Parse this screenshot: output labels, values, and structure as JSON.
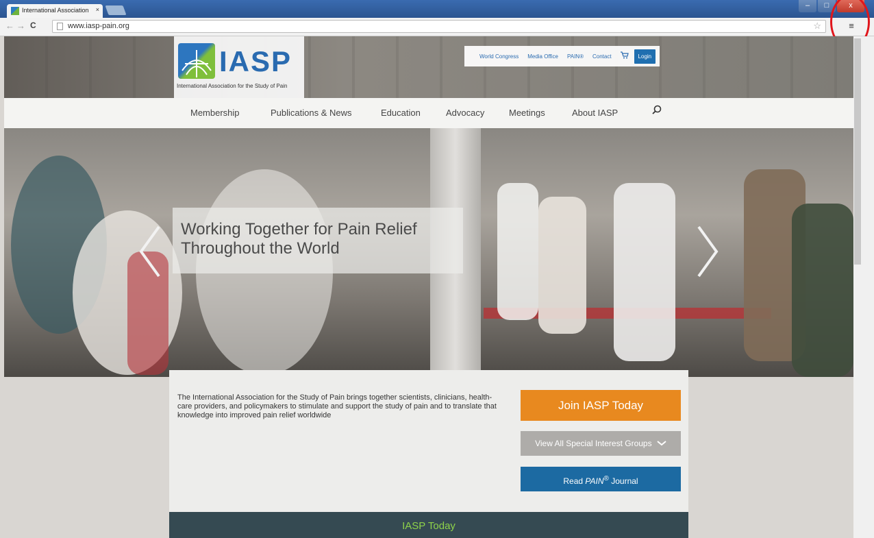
{
  "browser": {
    "tab_title": "International Association",
    "tab_close": "×",
    "url": "www.iasp-pain.org",
    "back_glyph": "←",
    "forward_glyph": "→",
    "reload_glyph": "C",
    "star_glyph": "☆",
    "menu_glyph": "≡",
    "window_controls": {
      "minimize": "–",
      "maximize": "□",
      "close": "x"
    }
  },
  "header": {
    "logo_text": "IASP",
    "logo_tagline": "International Association for the Study of Pain",
    "utility_links": [
      "World Congress",
      "Media Office",
      "PAIN®",
      "Contact"
    ],
    "login_label": "Login",
    "cart_icon": "cart-icon"
  },
  "nav": {
    "items": [
      "Membership",
      "Publications & News",
      "Education",
      "Advocacy",
      "Meetings",
      "About IASP"
    ],
    "search_icon": "search-icon"
  },
  "hero": {
    "caption_line1": "Working Together for Pain Relief",
    "caption_line2": "Throughout the World"
  },
  "content": {
    "mission": "The International Association for the Study of Pain brings together scientists, clinicians, health-care providers, and policymakers to stimulate and support the study of pain and to translate that knowledge into improved pain relief worldwide",
    "join_label": "Join IASP Today",
    "sig_label": "View All Special Interest Groups",
    "read_label_pre": "Read ",
    "read_label_em": "PAIN",
    "read_label_sup": "®",
    "read_label_post": " Journal",
    "today_title": "IASP Today"
  },
  "colors": {
    "brand_blue": "#2a6bb0",
    "join_orange": "#e8891f",
    "journal_blue": "#1c6aa2",
    "today_green": "#8fd34a",
    "annotation_red": "#e0161c"
  }
}
